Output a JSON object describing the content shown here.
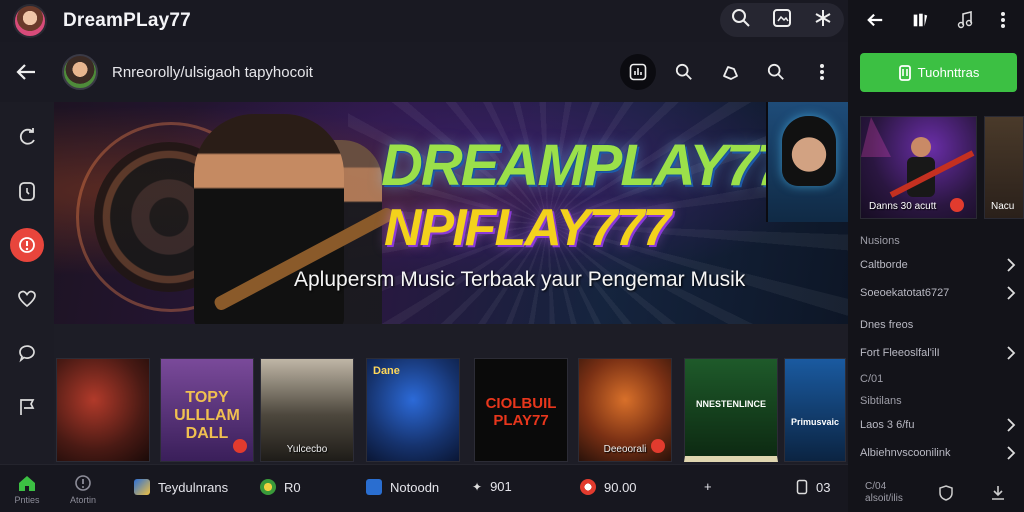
{
  "app": {
    "title": "DreamPLay77"
  },
  "header": {
    "text": "Rnreorolly/ulsigaoh tapyhocoit"
  },
  "hero": {
    "title_line1": "DREAMPLAY77",
    "title_line2": "NPIFLAY777",
    "subtitle": "Aplupersm Music Terbaak yaur Pengemar Musik"
  },
  "albums": [
    {
      "text": "",
      "caption": "",
      "badge": false
    },
    {
      "text": "TOPY ULLLAM DALL",
      "caption": "",
      "badge": true
    },
    {
      "text": "",
      "caption": "Yulcecbo",
      "badge": false
    },
    {
      "text": "Dane",
      "caption": "",
      "badge": false
    },
    {
      "text": "CIOLBUIL PLAY77",
      "caption": "",
      "badge": false
    },
    {
      "text": "",
      "caption": "Deeoorali",
      "badge": false
    },
    {
      "text": "NNESTENLINCE",
      "caption": "",
      "badge": false
    },
    {
      "text": "Primusvaic",
      "caption": "",
      "badge": false
    }
  ],
  "bottom_nav": {
    "home_label": "Pnties",
    "alerts_label": "Atortin",
    "items": [
      {
        "label": "Teydulnrans"
      },
      {
        "label": "R0"
      },
      {
        "label": "Notoodn"
      },
      {
        "label": "901"
      },
      {
        "label": "90.00"
      },
      {
        "label": "+"
      },
      {
        "label": "03"
      }
    ]
  },
  "right_panel": {
    "cta_label": "Tuohnttras",
    "card1_caption": "Danns 30 acutt",
    "card2_caption": "Nacu",
    "rows": [
      {
        "label": "Nusions",
        "chevron": false
      },
      {
        "label": "Caltborde",
        "chevron": true
      },
      {
        "label": "Soeoekatotat6727",
        "chevron": true
      },
      {
        "label": "Dnes freos",
        "chevron": false
      },
      {
        "label": "Fort Fleeoslfal'ilI",
        "chevron": true
      },
      {
        "label": "C/01",
        "chevron": false
      },
      {
        "label": "Sibtilans",
        "chevron": false
      },
      {
        "label": "Laos 3 6/fu",
        "chevron": true
      },
      {
        "label": "Albiehnvscoonilink",
        "chevron": true
      },
      {
        "label": "C/04",
        "chevron": false
      },
      {
        "label": "alsoit/ilis",
        "chevron": false
      }
    ]
  },
  "colors": {
    "accent_red": "#e8453c",
    "accent_green": "#3cc043",
    "title_green": "#9be04a",
    "title_yellow": "#f3d21c"
  },
  "icons": [
    "search-icon",
    "image-icon",
    "asterisk-icon",
    "back-arrow-icon",
    "analytics-icon",
    "cast-icon",
    "more-vertical-icon",
    "bookmark-icon",
    "info-icon",
    "timer-icon",
    "heart-icon",
    "chat-icon",
    "flag-icon",
    "home-icon",
    "music-note-icon",
    "chevron-right-icon",
    "download-icon",
    "shield-icon"
  ]
}
